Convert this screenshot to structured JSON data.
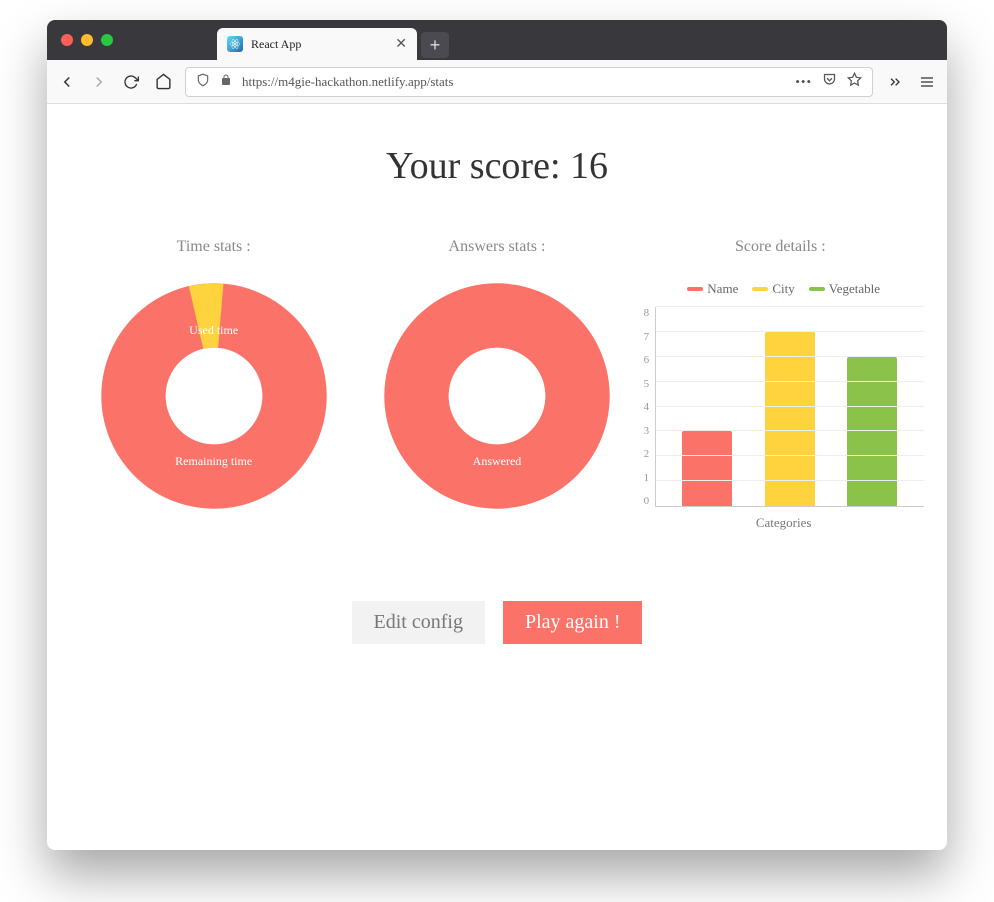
{
  "browser": {
    "tab_title": "React App",
    "url": "https://m4gie-hackathon.netlify.app/stats"
  },
  "page": {
    "score_label": "Your score: 16"
  },
  "panels": {
    "time": {
      "title": "Time stats :",
      "labels": {
        "used": "Used time",
        "remaining": "Remaining time"
      }
    },
    "answers": {
      "title": "Answers stats :",
      "labels": {
        "answered": "Answered"
      }
    },
    "score": {
      "title": "Score details :",
      "xlabel": "Categories"
    }
  },
  "buttons": {
    "edit": "Edit config",
    "play": "Play again !"
  },
  "colors": {
    "coral": "#fa7268",
    "yellow": "#ffd33d",
    "green": "#8bc34a"
  },
  "chart_data": [
    {
      "type": "pie",
      "title": "Time stats",
      "series": [
        {
          "name": "Used time",
          "value": 5,
          "color": "#ffd33d"
        },
        {
          "name": "Remaining time",
          "value": 95,
          "color": "#fa7268"
        }
      ]
    },
    {
      "type": "pie",
      "title": "Answers stats",
      "series": [
        {
          "name": "Answered",
          "value": 100,
          "color": "#fa7268"
        }
      ]
    },
    {
      "type": "bar",
      "title": "Score details",
      "xlabel": "Categories",
      "ylabel": "",
      "ylim": [
        0,
        8
      ],
      "yticks": [
        0,
        1,
        2,
        3,
        4,
        5,
        6,
        7,
        8
      ],
      "categories": [
        "Name",
        "City",
        "Vegetable"
      ],
      "series": [
        {
          "name": "Name",
          "values": [
            3
          ],
          "color": "#fa7268"
        },
        {
          "name": "City",
          "values": [
            7
          ],
          "color": "#ffd33d"
        },
        {
          "name": "Vegetable",
          "values": [
            6
          ],
          "color": "#8bc34a"
        }
      ],
      "values": [
        3,
        7,
        6
      ]
    }
  ]
}
